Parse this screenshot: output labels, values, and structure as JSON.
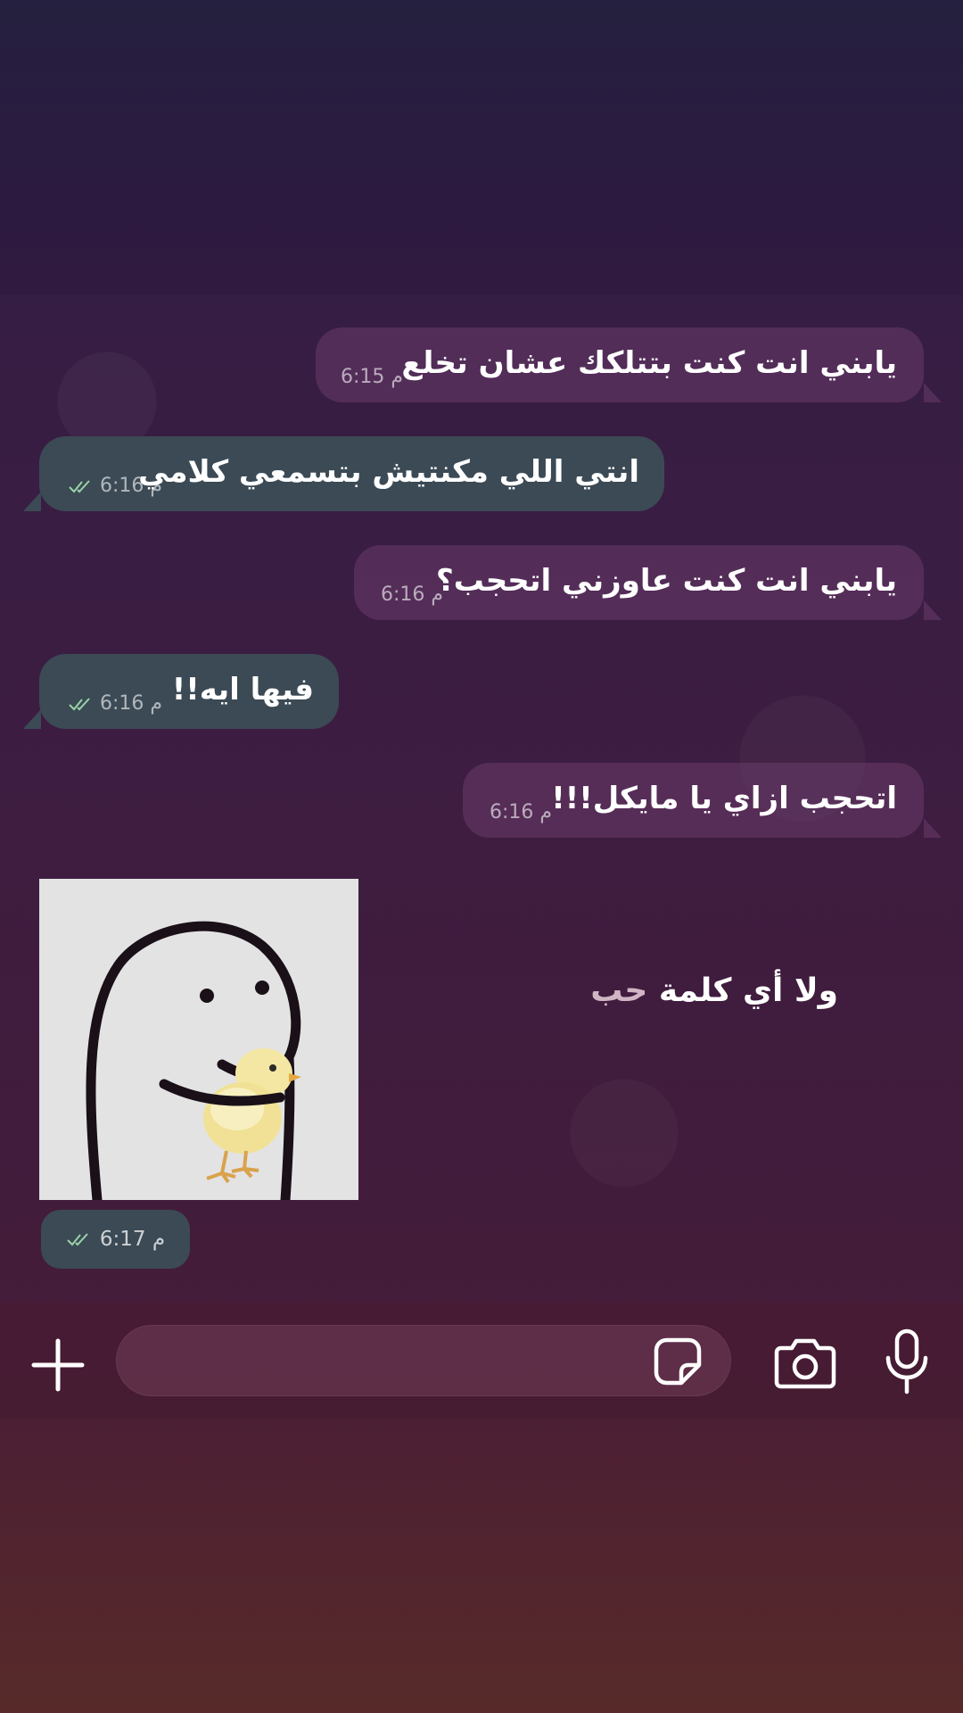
{
  "messages": [
    {
      "dir": "in",
      "text": "يابني انت كنت بتتلكك عشان تخلع",
      "time": "6:15 م"
    },
    {
      "dir": "out",
      "text": "انتي اللي مكنتيش بتسمعي كلامي",
      "time": "6:16 م"
    },
    {
      "dir": "in",
      "text": "يابني انت كنت عاوزني اتحجب؟",
      "time": "6:16 م"
    },
    {
      "dir": "out",
      "text": "فيها ايه!!",
      "time": "6:16 م"
    },
    {
      "dir": "in",
      "text": "اتحجب ازاي يا مايكل!!!",
      "time": "6:16 م"
    }
  ],
  "sticker": {
    "time": "6:17 م"
  },
  "caption": {
    "main": "ولا أي كلمة ",
    "highlight": "حب"
  },
  "input": {
    "placeholder": ""
  },
  "icons": {
    "add": "plus-icon",
    "sticker": "sticker-icon",
    "camera": "camera-icon",
    "mic": "microphone-icon",
    "read": "double-check-icon"
  },
  "colors": {
    "incoming_bubble": "#5a3a5e",
    "outgoing_bubble": "#3b4a55",
    "read_check": "#9bd3a8",
    "caption_highlight": "#d0b5c4"
  }
}
